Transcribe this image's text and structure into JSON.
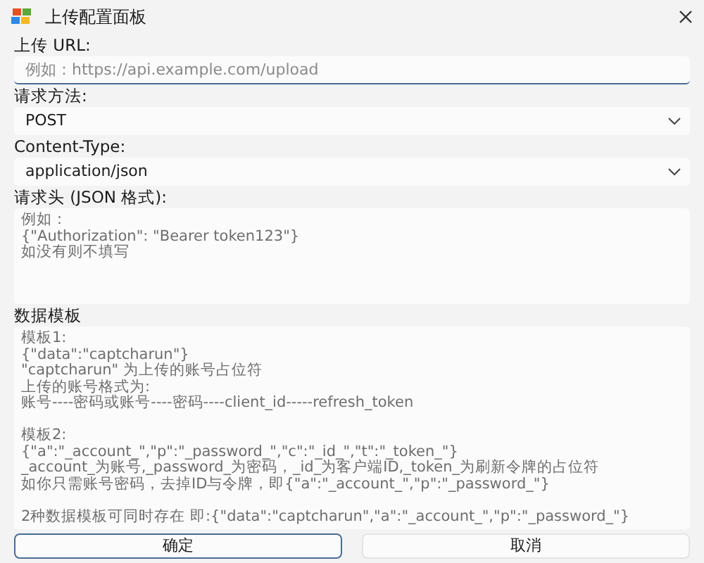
{
  "window": {
    "title": "上传配置面板"
  },
  "fields": [
    {
      "kind": "text",
      "label": "上传 URL:",
      "placeholder": "例如：https://api.example.com/upload",
      "focused": true
    },
    {
      "kind": "dropdown",
      "label": "请求方法:",
      "value": "POST"
    },
    {
      "kind": "dropdown",
      "label": "Content-Type:",
      "value": "application/json"
    },
    {
      "kind": "textarea",
      "label": "请求头 (JSON 格式):",
      "placeholder_blocks": [
        [
          "例如：",
          "{\"Authorization\": \"Bearer token123\"}",
          "如没有则不填写"
        ]
      ]
    },
    {
      "kind": "textarea",
      "label": "数据模板",
      "placeholder_blocks": [
        [
          "模板1:",
          "{\"data\":\"captcharun\"}",
          "\"captcharun\" 为上传的账号占位符",
          "上传的账号格式为:",
          "账号----密码或账号----密码----client_id-----refresh_token"
        ],
        [
          "模板2:",
          "{\"a\":\"_account_\",\"p\":\"_password_\",\"c\":\"_id_\",\"t\":\"_token_\"}",
          "_account_为账号,_password_为密码，_id_为客户端ID,_token_为刷新令牌的占位符",
          "如你只需账号密码，去掉ID与令牌，即{\"a\":\"_account_\",\"p\":\"_password_\"}"
        ],
        [
          "2种数据模板可同时存在 即:{\"data\":\"captcharun\",\"a\":\"_account_\",\"p\":\"_password_\"}"
        ]
      ]
    }
  ],
  "buttons": [
    {
      "label": "确定",
      "default": true
    },
    {
      "label": "取消",
      "default": false
    }
  ]
}
